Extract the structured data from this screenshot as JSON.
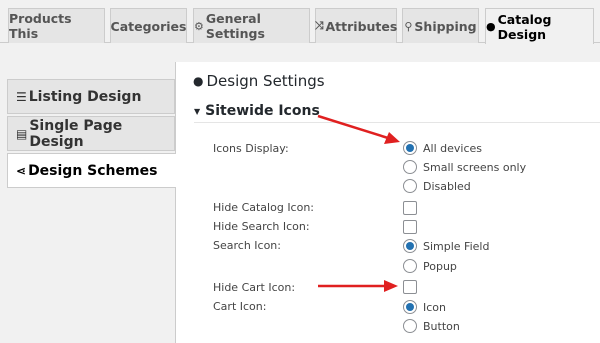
{
  "tabs": [
    {
      "label": "Products This",
      "icon": ""
    },
    {
      "label": "Categories",
      "icon": ""
    },
    {
      "label": "General Settings",
      "icon": "gear-icon"
    },
    {
      "label": "Attributes",
      "icon": "shuffle-icon"
    },
    {
      "label": "Shipping",
      "icon": "pin-icon"
    },
    {
      "label": "Catalog Design",
      "icon": "palette-icon",
      "active": true
    }
  ],
  "sidebar": {
    "items": [
      {
        "label": "Listing Design",
        "icon": "list-icon"
      },
      {
        "label": "Single Page Design",
        "icon": "page-icon"
      },
      {
        "label": "Design Schemes",
        "icon": "share-icon",
        "active": true
      }
    ]
  },
  "main": {
    "title": "Design Settings",
    "section": "Sitewide Icons",
    "icons_display": {
      "label": "Icons Display:",
      "options": [
        "All devices",
        "Small screens only",
        "Disabled"
      ],
      "selected": "All devices"
    },
    "hide_catalog_icon": {
      "label": "Hide Catalog Icon:"
    },
    "hide_search_icon": {
      "label": "Hide Search Icon:"
    },
    "search_icon": {
      "label": "Search Icon:",
      "options": [
        "Simple Field",
        "Popup"
      ],
      "selected": "Simple Field"
    },
    "hide_cart_icon": {
      "label": "Hide Cart Icon:"
    },
    "cart_icon": {
      "label": "Cart Icon:",
      "options": [
        "Icon",
        "Button"
      ],
      "selected": "Icon"
    }
  },
  "colors": {
    "accent": "#2271b1",
    "arrow": "#e02020"
  }
}
